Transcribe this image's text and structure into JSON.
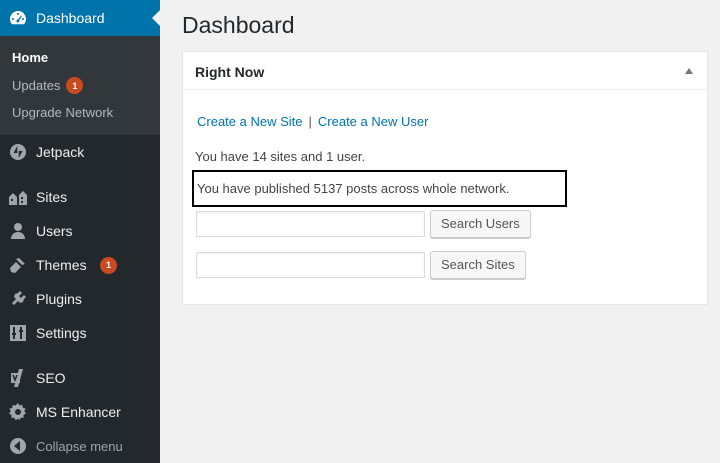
{
  "sidebar": {
    "dashboard": {
      "label": "Dashboard",
      "icon": "dashboard-icon"
    },
    "submenu": [
      {
        "label": "Home",
        "current": true
      },
      {
        "label": "Updates",
        "badge": "1"
      },
      {
        "label": "Upgrade Network"
      }
    ],
    "items": [
      {
        "label": "Jetpack",
        "icon": "jetpack-icon"
      },
      {
        "label": "Sites",
        "icon": "sites-icon"
      },
      {
        "label": "Users",
        "icon": "users-icon"
      },
      {
        "label": "Themes",
        "icon": "themes-icon",
        "badge": "1"
      },
      {
        "label": "Plugins",
        "icon": "plugins-icon"
      },
      {
        "label": "Settings",
        "icon": "settings-icon"
      },
      {
        "label": "SEO",
        "icon": "seo-icon"
      },
      {
        "label": "MS Enhancer",
        "icon": "gear-icon"
      }
    ],
    "collapse_label": "Collapse menu"
  },
  "main": {
    "title": "Dashboard",
    "right_now": {
      "title": "Right Now",
      "create_site": "Create a New Site",
      "separator": "|",
      "create_user": "Create a New User",
      "summary": "You have 14 sites and 1 user.",
      "posts": "You have published 5137 posts across whole network.",
      "search_users_value": "",
      "search_users_button": "Search Users",
      "search_sites_value": "",
      "search_sites_button": "Search Sites"
    }
  },
  "colors": {
    "sidebar_bg": "#23282d",
    "submenu_bg": "#32373c",
    "accent": "#0073aa",
    "badge": "#ca4a1f"
  }
}
